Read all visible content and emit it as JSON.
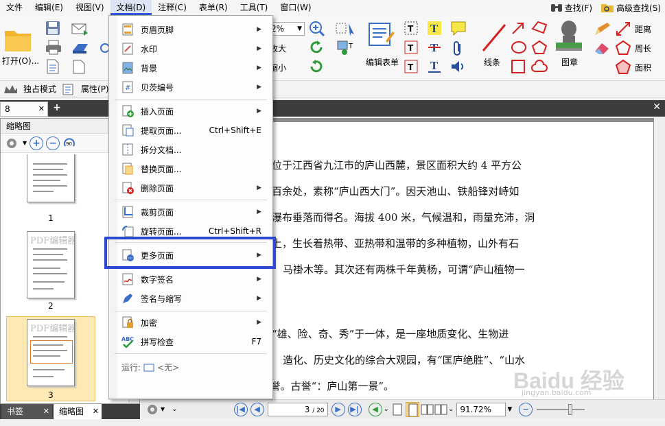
{
  "menubar": {
    "items": [
      "文件",
      "编辑(E)",
      "视图(V)",
      "文档(D)",
      "注释(C)",
      "表单(R)",
      "工具(T)",
      "窗口(W)"
    ],
    "right": [
      "查找(F)",
      "高级查找(S)"
    ]
  },
  "ribbon": {
    "open_label": "打开(O)...",
    "zoom_value": "2%",
    "zoom_in": "放大",
    "zoom_out": "缩小",
    "form_edit": "编辑表单",
    "lines": "线条",
    "stamp": "图章",
    "distance": "距离",
    "perimeter": "周长",
    "area": "面积"
  },
  "toolbar2": {
    "exclusive_mode": "独占模式",
    "properties": "属性(P)..."
  },
  "tabs": {
    "doc_tab": "8"
  },
  "leftpane": {
    "title": "缩略图",
    "thumb_watermark": "PDF编辑器",
    "thumbs": [
      "1",
      "2",
      "3"
    ]
  },
  "bottomtabs": {
    "bookmarks": "书签",
    "thumbnails": "缩略图"
  },
  "document": {
    "lines": [
      "位于江西省九江市的庐山西麓，景区面积大约 4 平方公",
      "百余处，素称“庐山西大门”。因天池山、铁船锋对峙如",
      "瀑布垂落而得名。海拔 400 米，气候温和，雨量充沛，洞",
      "土，生长着热带、亚热带和温带的多种植物，山外有石",
      "马褂木等。其次还有两株千年黄杨，可谓“庐山植物一",
      "“雄、险、奇、秀”于一体，是一座地质变化、生物进",
      "造化、历史文化的综合大观园，有“匡庐绝胜”、“山水",
      "绝胜”的美誉。古誉“：庐山第一景”。"
    ]
  },
  "statusbar": {
    "page_value": "3",
    "page_total": "/ 20",
    "zoom": "91.72%"
  },
  "dropdown": {
    "items": [
      {
        "label": "页眉页脚",
        "shortcut": "",
        "submenu": true
      },
      {
        "label": "水印",
        "shortcut": "",
        "submenu": true
      },
      {
        "label": "背景",
        "shortcut": "",
        "submenu": true
      },
      {
        "label": "贝茨编号",
        "shortcut": "",
        "submenu": true
      },
      {
        "label": "插入页面",
        "shortcut": "",
        "submenu": true
      },
      {
        "label": "提取页面...",
        "shortcut": "Ctrl+Shift+E",
        "submenu": false
      },
      {
        "label": "拆分文档...",
        "shortcut": "",
        "submenu": false
      },
      {
        "label": "替换页面...",
        "shortcut": "",
        "submenu": false
      },
      {
        "label": "删除页面",
        "shortcut": "",
        "submenu": true
      },
      {
        "label": "裁剪页面",
        "shortcut": "",
        "submenu": true
      },
      {
        "label": "旋转页面...",
        "shortcut": "Ctrl+Shift+R",
        "submenu": false
      },
      {
        "label": "更多页面",
        "shortcut": "",
        "submenu": true
      },
      {
        "label": "数字签名",
        "shortcut": "",
        "submenu": true
      },
      {
        "label": "签名与缩写",
        "shortcut": "",
        "submenu": true
      },
      {
        "label": "加密",
        "shortcut": "",
        "submenu": true
      },
      {
        "label": "拼写检查",
        "shortcut": "F7",
        "submenu": false
      }
    ],
    "run_label": "运行:",
    "run_value": "<无>",
    "arrow": "▶"
  },
  "watermark": {
    "brand": "Baidu 经验",
    "url": "jingyan.baidu.com"
  },
  "colors": {
    "accent": "#2f48d1",
    "menu_active_bg": "#dde4f3",
    "dark_strip": "#3d3d3d"
  }
}
